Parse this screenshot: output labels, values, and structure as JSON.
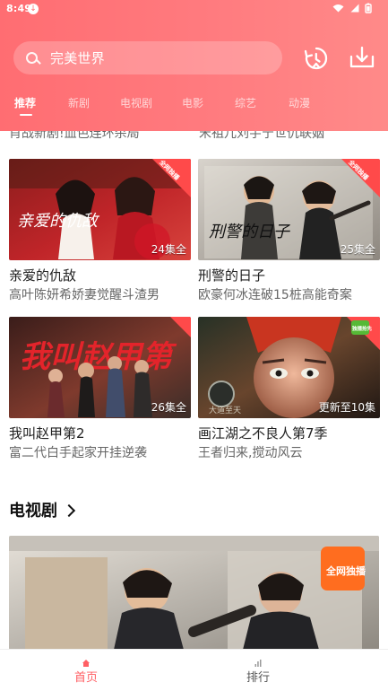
{
  "status_bar": {
    "time": "8:49",
    "notification_icon": "download-status-icon",
    "signal_icon": "wifi-icon",
    "battery_icon": "battery-icon"
  },
  "header": {
    "search": {
      "placeholder": "完美世界"
    },
    "history_icon": "history-icon",
    "download_icon": "download-icon"
  },
  "tabs": [
    {
      "label": "推荐",
      "active": true
    },
    {
      "label": "新剧"
    },
    {
      "label": "电视剧"
    },
    {
      "label": "电影"
    },
    {
      "label": "综艺"
    },
    {
      "label": "动漫"
    }
  ],
  "partial_row": {
    "left_desc": "肖战新剧!血色连环杀局",
    "right_desc": "宋祖儿刘宇宁世仇联姻"
  },
  "cards": [
    {
      "title": "亲爱的仇敌",
      "desc": "高叶陈妍希娇妻觉醒斗渣男",
      "badge": "24集全",
      "poster_text": "亲爱的仇敌",
      "corner_text": "全网独播"
    },
    {
      "title": "刑警的日子",
      "desc": "欧豪何冰连破15桩高能奇案",
      "badge": "25集全",
      "poster_text": "刑警的日子",
      "corner_text": "全网独播"
    },
    {
      "title": "我叫赵甲第2",
      "desc": "富二代白手起家开挂逆袭",
      "badge": "26集全",
      "poster_text": "我叫赵甲第"
    },
    {
      "title": "画江湖之不良人第7季",
      "desc": "王者归来,搅动风云",
      "badge": "更新至10集",
      "poster_text": "大道至天",
      "corner_text": "独播抢先"
    }
  ],
  "section": {
    "title": "电视剧",
    "poster_corner_text": "全网独播"
  },
  "bottom_nav": {
    "home_label": "首页",
    "rank_label": "排行"
  },
  "colors": {
    "header_start": "#ff6d72",
    "header_end": "#ff8a89",
    "accent": "#ff5f64"
  }
}
